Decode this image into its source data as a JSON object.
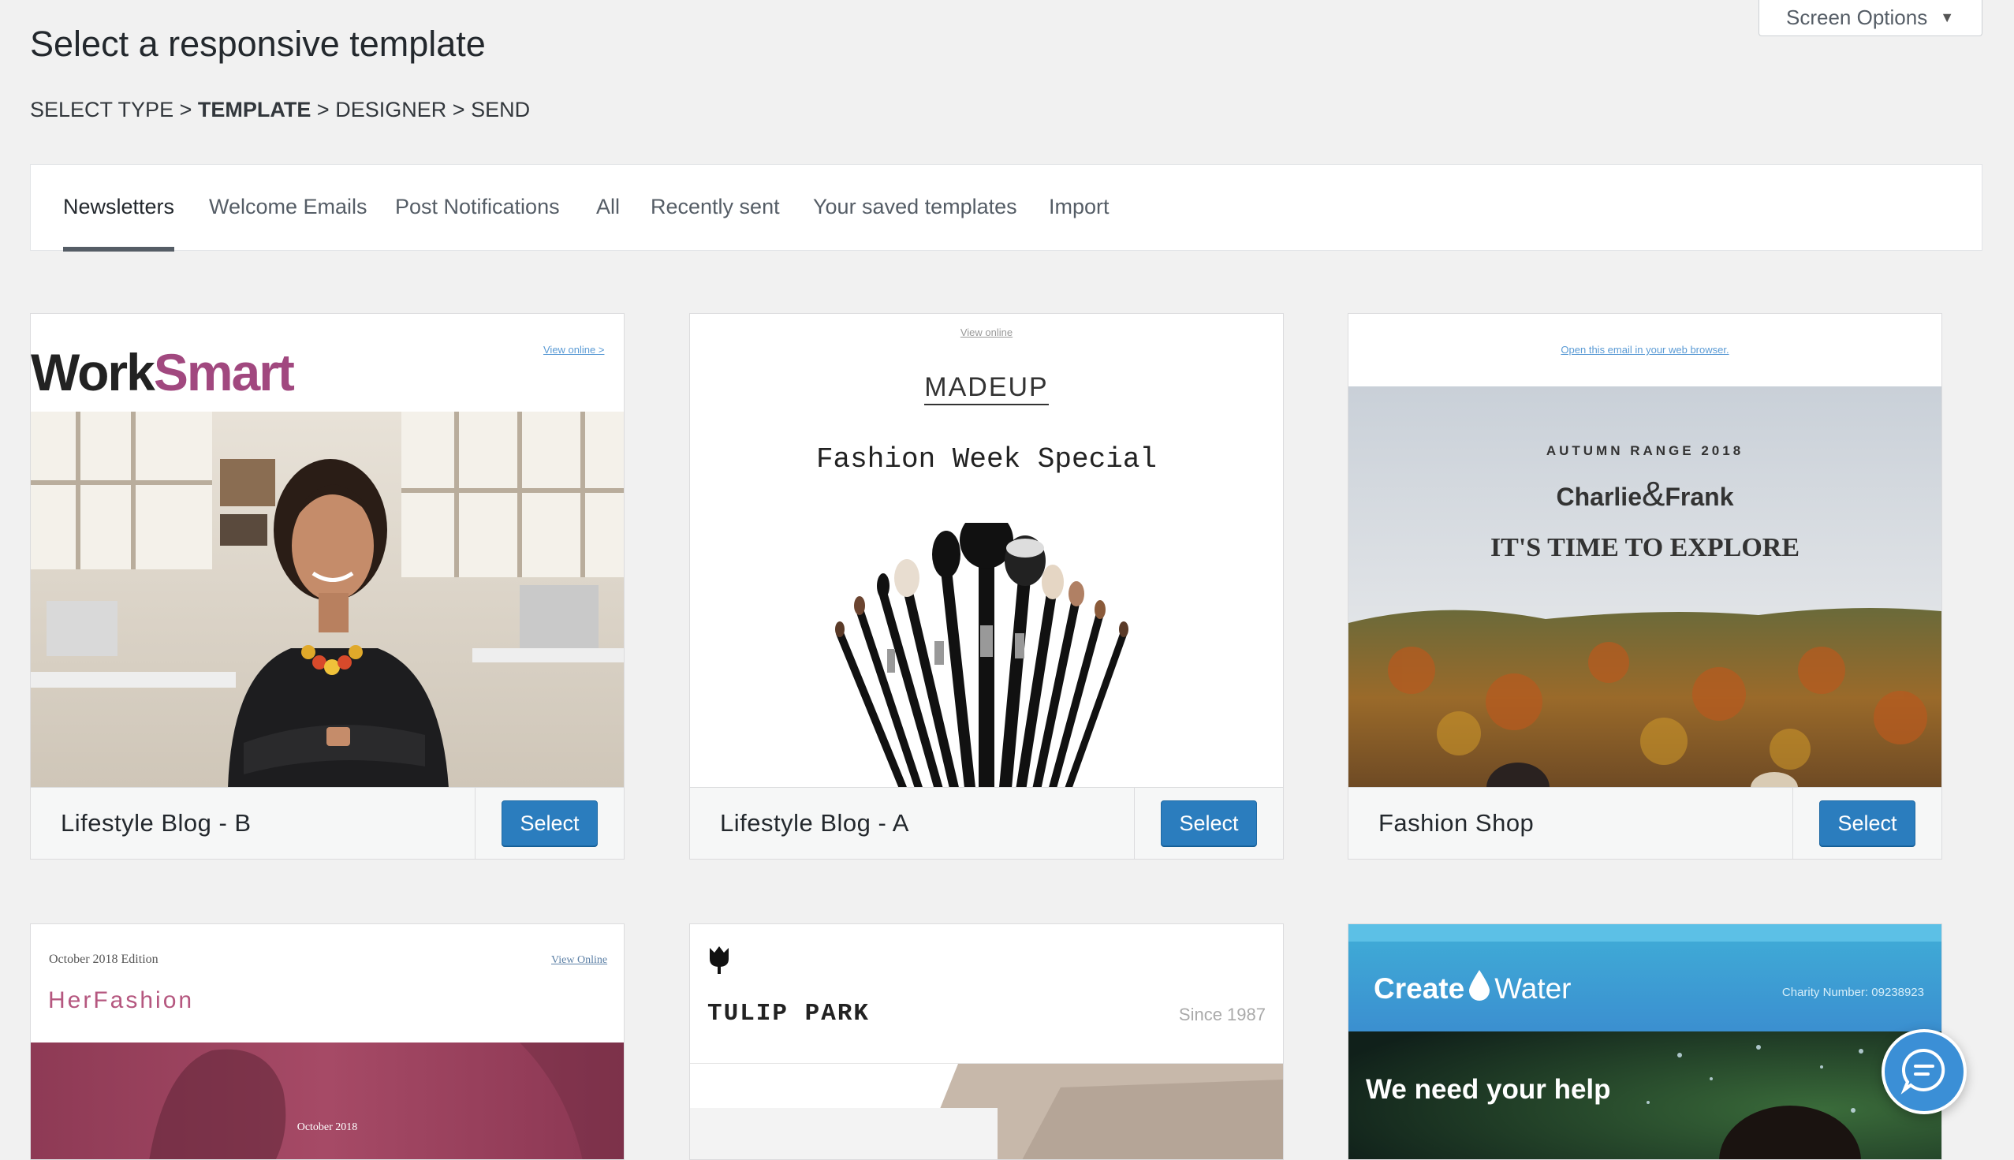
{
  "header": {
    "title": "Select a responsive template",
    "screen_options": "Screen Options"
  },
  "breadcrumb": {
    "step1": "SELECT TYPE",
    "step2": "TEMPLATE",
    "step3": "DESIGNER",
    "step4": "SEND",
    "separator": ">"
  },
  "tabs": [
    {
      "label": "Newsletters",
      "active": true
    },
    {
      "label": "Welcome Emails"
    },
    {
      "label": "Post Notifications"
    },
    {
      "label": "All"
    },
    {
      "label": "Recently sent"
    },
    {
      "label": "Your saved templates"
    },
    {
      "label": "Import"
    }
  ],
  "cards": [
    {
      "name": "Lifestyle Blog - B",
      "select": "Select",
      "preview": {
        "brand_part1": "Work",
        "brand_part2": "Smart",
        "link": "View online >"
      }
    },
    {
      "name": "Lifestyle Blog - A",
      "select": "Select",
      "preview": {
        "link": "View online",
        "brand": "MADEUP",
        "headline": "Fashion Week Special"
      }
    },
    {
      "name": "Fashion Shop",
      "select": "Select",
      "preview": {
        "link": "Open this email in your web browser.",
        "kicker": "AUTUMN RANGE 2018",
        "brand_part1": "Charlie",
        "brand_amp": "&",
        "brand_part2": "Frank",
        "headline": "IT'S TIME TO EXPLORE"
      }
    },
    {
      "preview": {
        "edition": "October 2018 Edition",
        "link": "View Online",
        "brand": "HerFashion",
        "footer_text": "October 2018"
      }
    },
    {
      "preview": {
        "brand": "TULIP PARK",
        "since": "Since 1987"
      }
    },
    {
      "preview": {
        "brand_part1": "Create",
        "brand_part2": "Water",
        "charity": "Charity Number: 09238923",
        "headline": "We need your help"
      }
    }
  ],
  "colors": {
    "accent": "#2b7dbe",
    "worksmart_pink": "#a1487f",
    "herfashion_pink": "#b5577f",
    "createwater_blue": "#3fa9d6"
  },
  "icons": {
    "screen_options": "caret-down-icon",
    "chat": "chat-bubble-icon",
    "tulip": "tulip-icon",
    "water": "water-drop-icon"
  }
}
